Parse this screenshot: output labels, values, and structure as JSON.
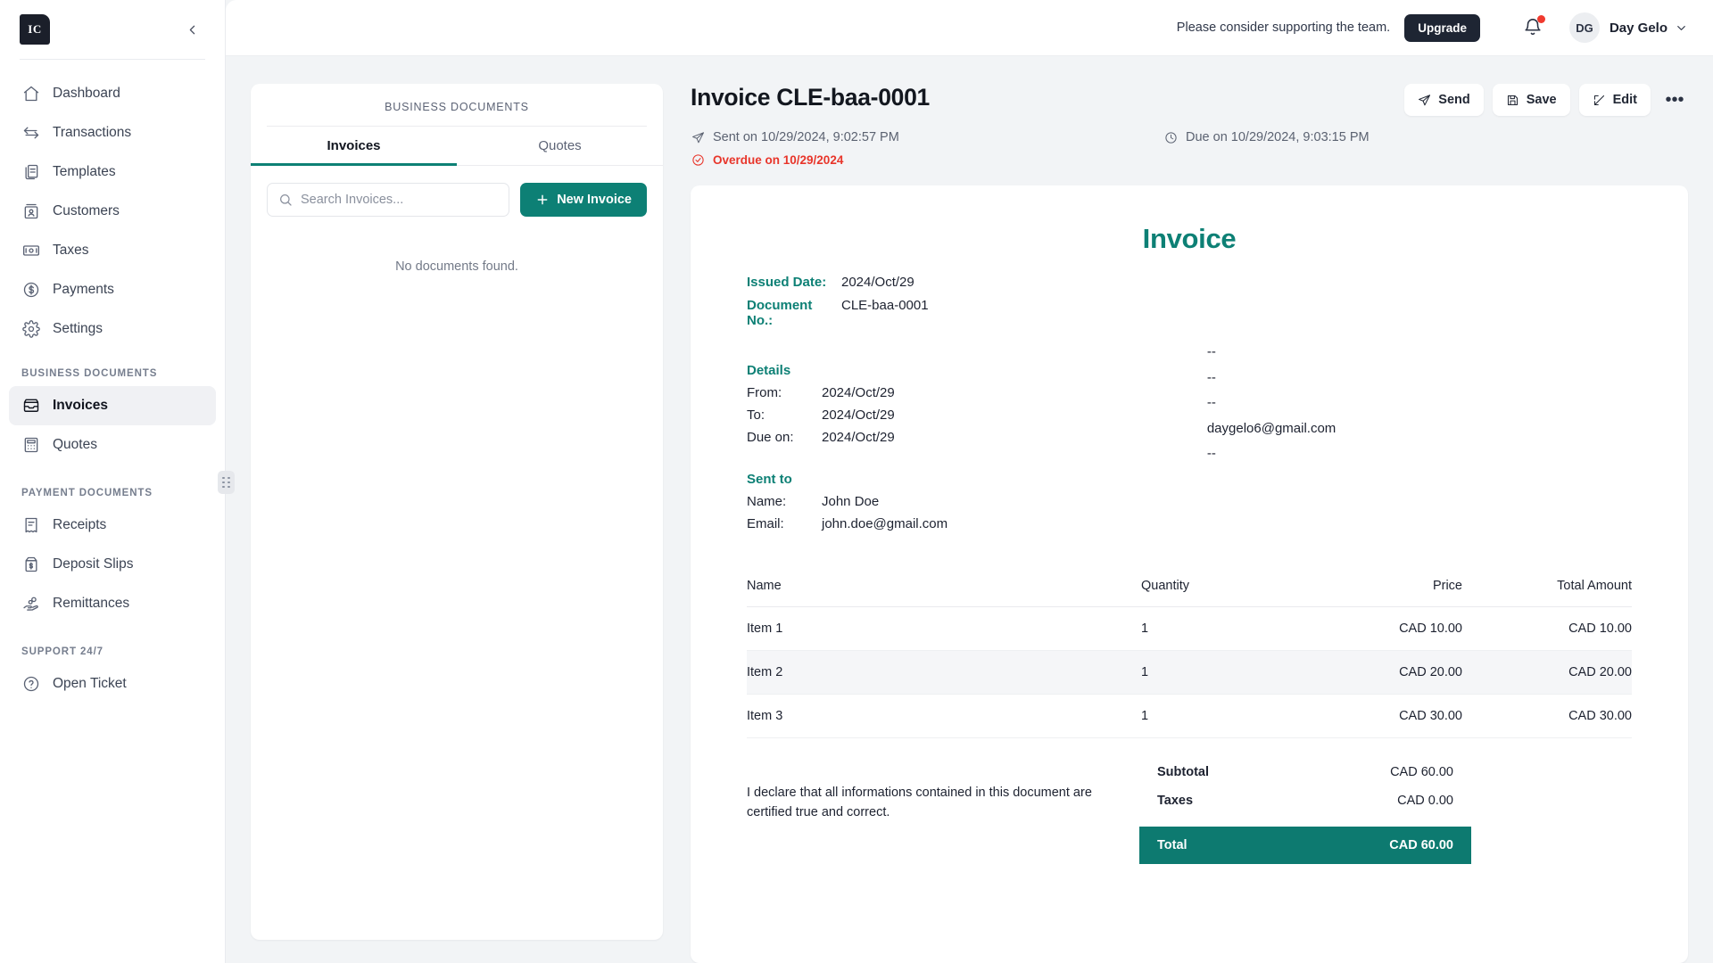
{
  "sidebar": {
    "logo": "IC",
    "collapse_icon": "chevron-left-icon",
    "nav": [
      {
        "label": "Dashboard",
        "icon": "home-icon"
      },
      {
        "label": "Transactions",
        "icon": "transfer-arrows-icon"
      },
      {
        "label": "Templates",
        "icon": "documents-icon"
      },
      {
        "label": "Customers",
        "icon": "id-card-icon"
      },
      {
        "label": "Taxes",
        "icon": "banknote-icon"
      },
      {
        "label": "Payments",
        "icon": "dollar-circle-icon"
      },
      {
        "label": "Settings",
        "icon": "gear-icon"
      }
    ],
    "sections": [
      {
        "label": "BUSINESS DOCUMENTS",
        "items": [
          {
            "label": "Invoices",
            "icon": "inbox-tray-icon",
            "active": true
          },
          {
            "label": "Quotes",
            "icon": "calculator-icon",
            "active": false
          }
        ]
      },
      {
        "label": "PAYMENT DOCUMENTS",
        "items": [
          {
            "label": "Receipts",
            "icon": "receipt-icon",
            "active": false
          },
          {
            "label": "Deposit Slips",
            "icon": "deposit-bag-icon",
            "active": false
          },
          {
            "label": "Remittances",
            "icon": "hand-coins-icon",
            "active": false
          }
        ]
      },
      {
        "label": "SUPPORT 24/7",
        "items": [
          {
            "label": "Open Ticket",
            "icon": "question-circle-icon",
            "active": false
          }
        ]
      }
    ]
  },
  "topbar": {
    "support_text": "Please consider supporting the team.",
    "upgrade_label": "Upgrade",
    "bell_icon": "bell-icon",
    "has_notification": true,
    "avatar_initials": "DG",
    "user_name": "Day Gelo",
    "chevron_icon": "chevron-down-icon"
  },
  "list_panel": {
    "title": "BUSINESS DOCUMENTS",
    "tabs": [
      {
        "label": "Invoices",
        "active": true
      },
      {
        "label": "Quotes",
        "active": false
      }
    ],
    "search": {
      "placeholder": "Search Invoices...",
      "value": "",
      "icon": "search-icon"
    },
    "new_button": {
      "label": "New Invoice",
      "icon": "plus-icon"
    },
    "empty_message": "No documents found."
  },
  "document": {
    "title": "Invoice CLE-baa-0001",
    "actions": [
      {
        "label": "Send",
        "icon": "send-icon"
      },
      {
        "label": "Save",
        "icon": "floppy-disk-icon"
      },
      {
        "label": "Edit",
        "icon": "pencil-square-icon"
      }
    ],
    "more_label": "•••",
    "meta": {
      "sent": "Sent on 10/29/2024, 9:02:57 PM",
      "sent_icon": "send-icon",
      "overdue": "Overdue on 10/29/2024",
      "overdue_icon": "check-circle-icon",
      "due": "Due on 10/29/2024, 9:03:15 PM",
      "due_icon": "clock-icon"
    }
  },
  "invoice": {
    "heading": "Invoice",
    "issued_date_label": "Issued Date:",
    "issued_date_value": "2024/Oct/29",
    "document_no_label": "Document No.:",
    "document_no_value": "CLE-baa-0001",
    "details_title": "Details",
    "details": [
      {
        "label": "From:",
        "value": "2024/Oct/29"
      },
      {
        "label": "To:",
        "value": "2024/Oct/29"
      },
      {
        "label": "Due on:",
        "value": "2024/Oct/29"
      }
    ],
    "issuer_lines": [
      "--",
      "--",
      "--",
      "daygelo6@gmail.com",
      "--"
    ],
    "sent_to_title": "Sent to",
    "sent_to": [
      {
        "label": "Name:",
        "value": "John Doe"
      },
      {
        "label": "Email:",
        "value": "john.doe@gmail.com"
      }
    ],
    "table": {
      "headers": [
        "Name",
        "Quantity",
        "Price",
        "Total Amount"
      ],
      "rows": [
        {
          "name": "Item 1",
          "quantity": "1",
          "price": "CAD 10.00",
          "total": "CAD 10.00"
        },
        {
          "name": "Item 2",
          "quantity": "1",
          "price": "CAD 20.00",
          "total": "CAD 20.00"
        },
        {
          "name": "Item 3",
          "quantity": "1",
          "price": "CAD 30.00",
          "total": "CAD 30.00"
        }
      ]
    },
    "declaration": "I declare that all informations contained in this document are certified true and correct.",
    "totals": [
      {
        "label": "Subtotal",
        "value": "CAD 60.00"
      },
      {
        "label": "Taxes",
        "value": "CAD 0.00"
      }
    ],
    "grand_total": {
      "label": "Total",
      "value": "CAD 60.00"
    }
  },
  "colors": {
    "accent_teal": "#0d8075",
    "total_bar": "#0d7a70",
    "overdue_red": "#e8352a",
    "dark": "#1e2533",
    "notification_dot": "#f03a2e"
  }
}
